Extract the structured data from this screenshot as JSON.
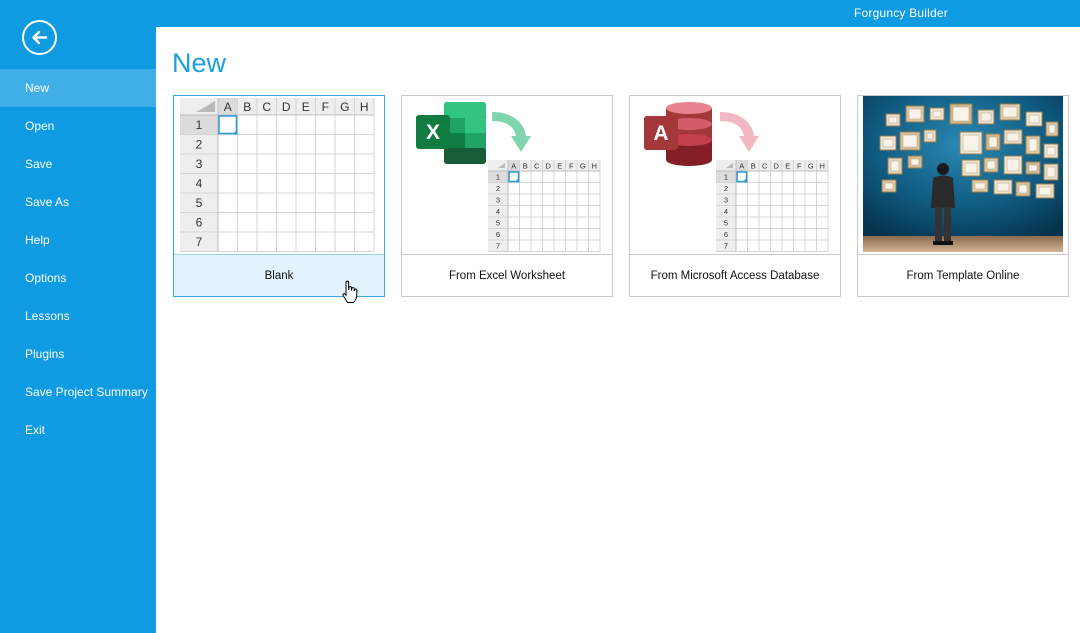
{
  "window": {
    "title": "Forguncy Builder"
  },
  "page": {
    "title": "New"
  },
  "sidebar": {
    "items": [
      {
        "label": "New",
        "active": true
      },
      {
        "label": "Open"
      },
      {
        "label": "Save"
      },
      {
        "label": "Save As"
      },
      {
        "label": "Help"
      },
      {
        "label": "Options"
      },
      {
        "label": "Lessons"
      },
      {
        "label": "Plugins"
      },
      {
        "label": "Save Project Summary"
      },
      {
        "label": "Exit"
      }
    ]
  },
  "templates": [
    {
      "label": "Blank",
      "icon": "spreadsheet-grid-icon",
      "selected": true
    },
    {
      "label": "From Excel Worksheet",
      "icon": "excel-icon"
    },
    {
      "label": "From Microsoft Access Database",
      "icon": "access-icon"
    },
    {
      "label": "From Template Online",
      "icon": "gallery-photo"
    }
  ],
  "grid": {
    "columns": [
      "A",
      "B",
      "C",
      "D",
      "E",
      "F",
      "G",
      "H"
    ],
    "rows": [
      "1",
      "2",
      "3",
      "4",
      "5",
      "6",
      "7"
    ]
  },
  "colors": {
    "accent": "#0e9be2",
    "menu_active": "#40aee8",
    "title": "#1aa0e2",
    "excel": "#1d6f42",
    "access": "#a4373a"
  }
}
